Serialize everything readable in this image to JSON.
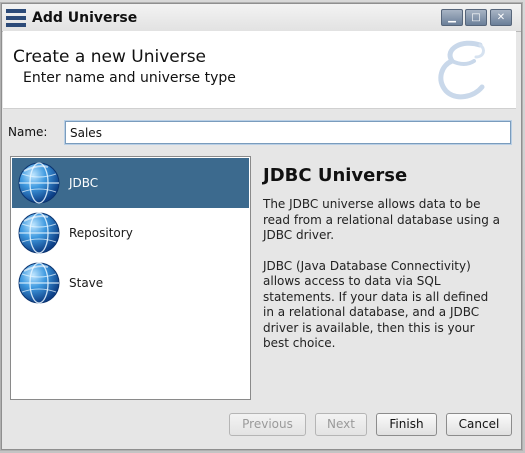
{
  "window": {
    "title": "Add Universe",
    "controls": {
      "minimize": "▁",
      "maximize": "□",
      "close": "✕"
    }
  },
  "header": {
    "title": "Create a new Universe",
    "subtitle": "Enter name and universe type"
  },
  "name_field": {
    "label": "Name:",
    "value": "Sales"
  },
  "universe_types": [
    {
      "label": "JDBC",
      "icon": "globe-icon",
      "selected": true
    },
    {
      "label": "Repository",
      "icon": "globe-icon",
      "selected": false
    },
    {
      "label": "Stave",
      "icon": "globe-icon",
      "selected": false
    }
  ],
  "description": {
    "title": "JDBC Universe",
    "paragraphs": [
      "The JDBC universe allows data to be read from a relational database using a JDBC driver.",
      "JDBC (Java Database Connectivity) allows access to data via SQL statements. If your data is all defined in a relational database, and a JDBC driver is available, then this is your best choice."
    ]
  },
  "buttons": {
    "previous": "Previous",
    "next": "Next",
    "finish": "Finish",
    "cancel": "Cancel"
  },
  "colors": {
    "selection": "#3c6a8e",
    "input_border": "#7a9cbd"
  }
}
